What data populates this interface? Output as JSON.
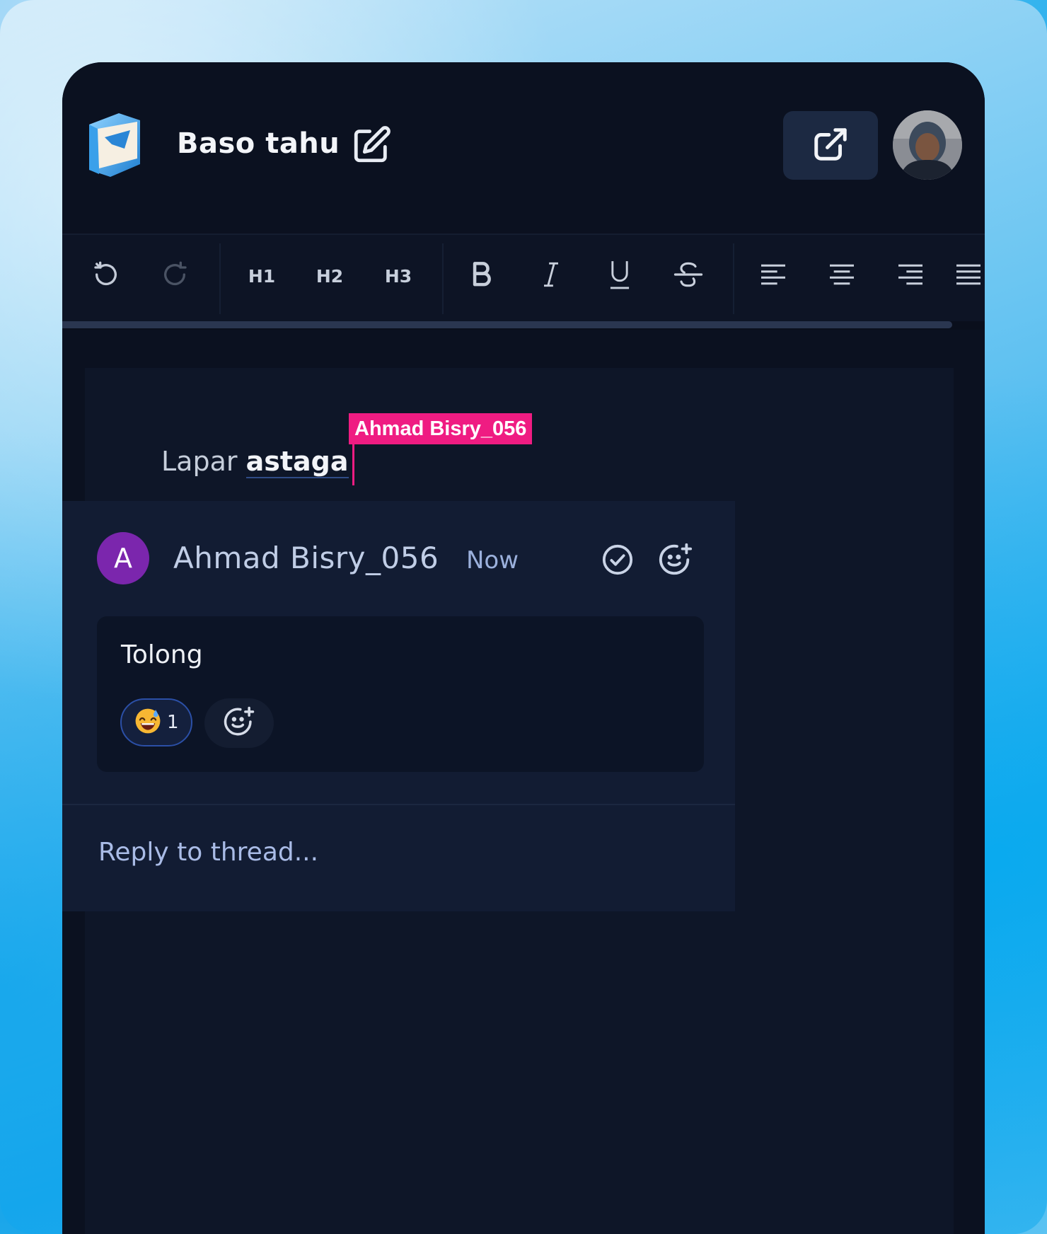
{
  "document": {
    "title": "Baso tahu"
  },
  "header": {
    "logo_icon": "folder-book-icon",
    "edit_icon": "edit-icon",
    "share_icon": "external-link-icon",
    "avatar": "user-avatar"
  },
  "toolbar": {
    "undo_icon": "undo-icon",
    "redo_icon": "redo-icon",
    "h1": "H1",
    "h2": "H2",
    "h3": "H3",
    "bold_icon": "bold-icon",
    "italic_icon": "italic-icon",
    "underline_icon": "underline-icon",
    "strike_icon": "strikethrough-icon",
    "align_left_icon": "align-left-icon",
    "align_center_icon": "align-center-icon",
    "align_right_icon": "align-right-icon",
    "align_justify_icon": "align-justify-icon"
  },
  "editor": {
    "text_plain": "Lapar ",
    "text_highlighted": "astaga",
    "cursor_label": "Ahmad Bisry_056",
    "cursor_color": "#ef1c82"
  },
  "thread": {
    "author_initial": "A",
    "author_name": "Ahmad Bisry_056",
    "time": "Now",
    "avatar_color": "#7b26ad",
    "comment": "Tolong",
    "reaction_emoji": "grinning-sweat-emoji",
    "reaction_count": "1",
    "reply_placeholder": "Reply to thread..."
  }
}
